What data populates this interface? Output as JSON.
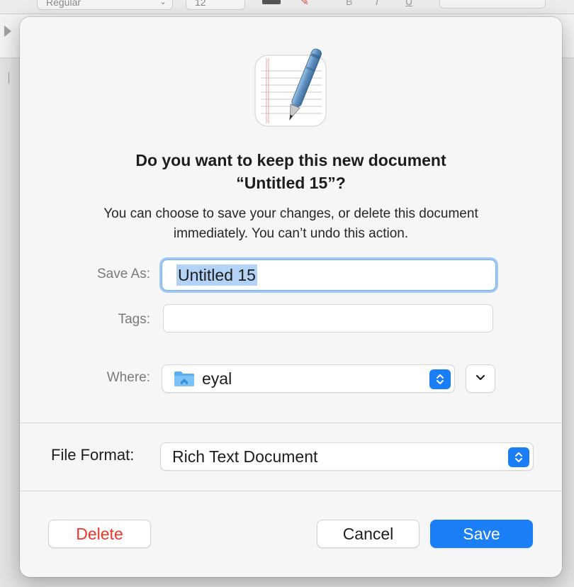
{
  "background": {
    "font_style_value": "Regular",
    "font_size_value": "12"
  },
  "dialog": {
    "title_line1": "Do you want to keep this new document",
    "title_line2": "“Untitled 15”?",
    "subtitle_line1": "You can choose to save your changes, or delete this document",
    "subtitle_line2": "immediately. You can’t undo this action.",
    "save_as_label": "Save As:",
    "save_as_value": "Untitled 15",
    "tags_label": "Tags:",
    "tags_value": "",
    "where_label": "Where:",
    "where_value": "eyal",
    "where_icon": "home-folder-icon",
    "file_format_label": "File Format:",
    "file_format_value": "Rich Text Document",
    "delete_label": "Delete",
    "cancel_label": "Cancel",
    "save_label": "Save",
    "app_icon": "textedit-icon"
  },
  "colors": {
    "accent": "#1a7ef6",
    "destructive": "#f2362a",
    "selection": "#b3d2f5",
    "focus_ring": "#9ec7f6"
  }
}
